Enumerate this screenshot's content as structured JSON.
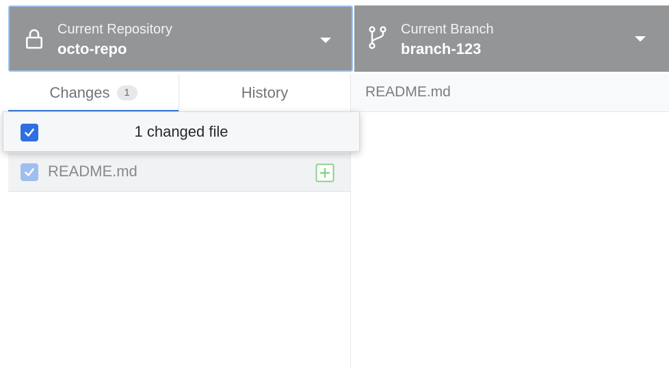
{
  "toolbar": {
    "repository": {
      "label": "Current Repository",
      "value": "octo-repo",
      "icon": "lock-icon"
    },
    "branch": {
      "label": "Current Branch",
      "value": "branch-123",
      "icon": "git-branch-icon"
    }
  },
  "tabs": {
    "changes": {
      "label": "Changes",
      "count": "1",
      "selected": true
    },
    "history": {
      "label": "History"
    }
  },
  "changes_list": {
    "header_text": "1 changed file",
    "select_all_checked": true,
    "files": [
      {
        "name": "README.md",
        "checked": true,
        "status_icon": "file-added-icon"
      }
    ]
  },
  "diff": {
    "filename": "README.md"
  },
  "colors": {
    "toolbar_bg": "#939596",
    "accent_blue": "#2f6fe4",
    "added_green": "#5cb85c"
  }
}
